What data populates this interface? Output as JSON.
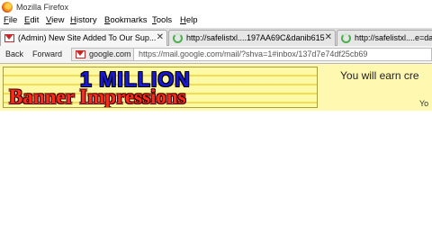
{
  "window": {
    "title": "Mozilla Firefox",
    "icon": "firefox-icon"
  },
  "menubar": {
    "items": [
      "File",
      "Edit",
      "View",
      "History",
      "Bookmarks",
      "Tools",
      "Help"
    ]
  },
  "tabs": [
    {
      "label": "(Admin) New Site Added To Our Sup...",
      "icon": "gmail-icon",
      "active": true,
      "close": "✕"
    },
    {
      "label": "http://safelistxl....197AA69C&danib615",
      "icon": "loading-icon",
      "active": false,
      "close": "✕"
    },
    {
      "label": "http://safelistxl....e=da",
      "icon": "loading-icon",
      "active": false
    }
  ],
  "navbar": {
    "back_label": "Back",
    "forward_label": "Forward",
    "site_name": "google.com",
    "url": "https://mail.google.com/mail/?shva=1#inbox/137d7e74df25cb69"
  },
  "content": {
    "banner": {
      "line1": "1 MILLION",
      "line2": "Banner Impressions"
    },
    "promo_text": "You will earn cre",
    "promo_subtext": "Yo"
  }
}
